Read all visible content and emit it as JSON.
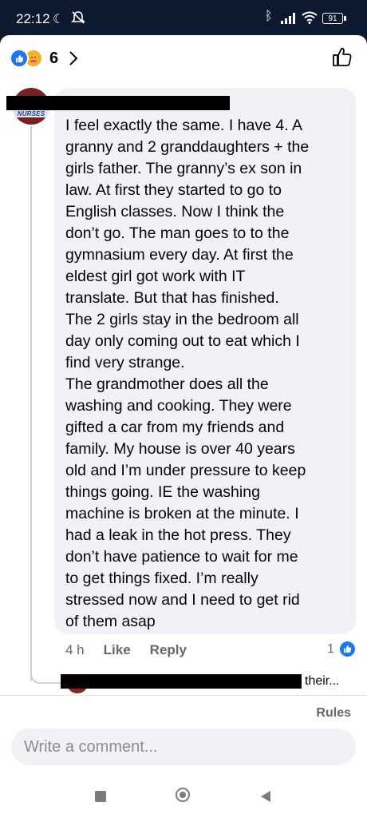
{
  "status_bar": {
    "time": "22:12",
    "battery": "91"
  },
  "reactions": {
    "count": "6"
  },
  "comment": {
    "avatar_badge": "NURSES",
    "text": "I feel exactly the same. I have 4. A\ngranny and 2 granddaughters + the\ngirls father. The granny’s ex son in\nlaw. At first they started to go to\nEnglish classes. Now I think the\ndon’t go. The man goes to to the\ngymnasium every day. At first the\neldest girl got work with IT\ntranslate. But that has finished.\nThe 2 girls stay in the bedroom all\nday only coming out to eat which I\nfind very strange.\nThe grandmother does all the\nwashing and cooking. They were\ngifted a car from my friends and\nfamily. My house is over 40 years\nold and I’m under pressure to keep\nthings going. IE the washing\nmachine is broken at the minute. I\nhad a leak in the hot press. They\ndon’t have patience to wait for me\nto get things fixed. I’m really\nstressed now and I need to get rid\nof them asap",
    "time_ago": "4 h",
    "like_label": "Like",
    "reply_label": "Reply",
    "reaction_count": "1"
  },
  "reply_preview": {
    "snippet": "their..."
  },
  "footer": {
    "rules_label": "Rules",
    "comment_placeholder": "Write a comment..."
  },
  "colors": {
    "accent": "#1877f2",
    "status_bar_bg": "#0b1a2e",
    "bubble_bg": "#f0f2f5",
    "secondary_text": "#65676b"
  }
}
